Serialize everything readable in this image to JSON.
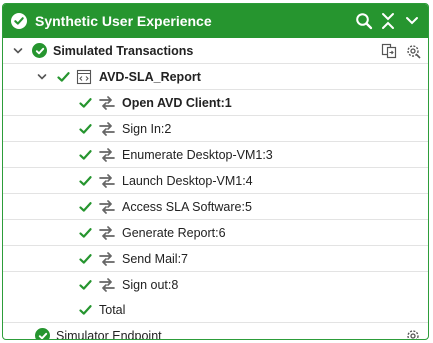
{
  "header": {
    "title": "Synthetic User Experience",
    "icons": [
      "check-circle-icon",
      "search-icon",
      "collapse-icon",
      "chevron-down-icon"
    ]
  },
  "tree": {
    "group": {
      "label": "Simulated Transactions",
      "icons": [
        "copy-page-icon",
        "settings-gear-icon"
      ]
    },
    "report": {
      "label": "AVD-SLA_Report",
      "icon": "code-page-icon"
    },
    "steps": [
      {
        "label": "Open AVD Client:1",
        "bold": true
      },
      {
        "label": "Sign In:2"
      },
      {
        "label": "Enumerate Desktop-VM1:3"
      },
      {
        "label": "Launch Desktop-VM1:4"
      },
      {
        "label": "Access SLA Software:5"
      },
      {
        "label": "Generate Report:6"
      },
      {
        "label": "Send Mail:7"
      },
      {
        "label": "Sign out:8"
      }
    ],
    "total": {
      "label": "Total"
    },
    "endpoint": {
      "label": "Simulator Endpoint",
      "icon": "settings-gear-icon"
    }
  },
  "colors": {
    "accent": "#26952f",
    "divider": "#e3e3e3",
    "text": "#222222",
    "icon_gray": "#666666"
  }
}
